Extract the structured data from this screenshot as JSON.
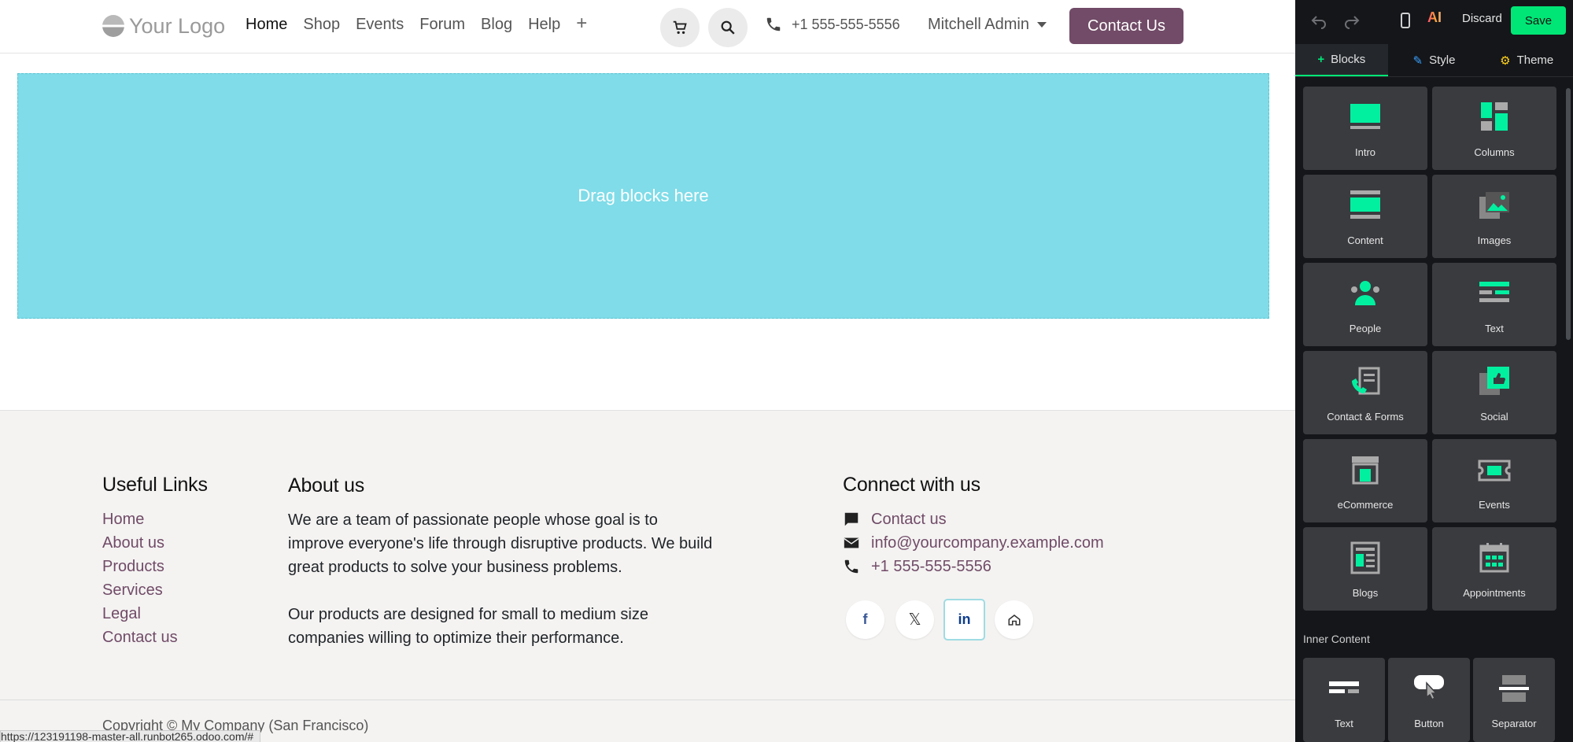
{
  "nav": {
    "logo_text": "Your Logo",
    "menu": [
      {
        "label": "Home"
      },
      {
        "label": "Shop"
      },
      {
        "label": "Events"
      },
      {
        "label": "Forum"
      },
      {
        "label": "Blog"
      },
      {
        "label": "Help"
      }
    ],
    "add_menu_label": "+",
    "phone": "+1 555-555-5556",
    "user": "Mitchell Admin",
    "contact_button": "Contact Us"
  },
  "dropzone": {
    "label": "Drag blocks here"
  },
  "footer": {
    "useful_links": {
      "title": "Useful Links",
      "items": [
        "Home",
        "About us",
        "Products",
        "Services",
        "Legal",
        "Contact us"
      ]
    },
    "about": {
      "title": "About us",
      "p1": "We are a team of passionate people whose goal is to improve everyone's life through disruptive products. We build great products to solve your business problems.",
      "p2": "Our products are designed for small to medium size companies willing to optimize their performance."
    },
    "connect": {
      "title": "Connect with us",
      "contact": "Contact us",
      "email": "info@yourcompany.example.com",
      "phone": "+1 555-555-5556"
    },
    "copyright": "Copyright © My Company (San Francisco)"
  },
  "status_url": "https://123191198-master-all.runbot265.odoo.com/#",
  "editor": {
    "discard": "Discard",
    "save": "Save",
    "ai_label": "AI",
    "tabs": [
      {
        "label": "Blocks",
        "icon": "plus"
      },
      {
        "label": "Style",
        "icon": "pencil"
      },
      {
        "label": "Theme",
        "icon": "gear"
      }
    ],
    "blocks": [
      {
        "label": "Intro",
        "icon": "intro-icon"
      },
      {
        "label": "Columns",
        "icon": "columns-icon"
      },
      {
        "label": "Content",
        "icon": "content-icon"
      },
      {
        "label": "Images",
        "icon": "images-icon"
      },
      {
        "label": "People",
        "icon": "people-icon"
      },
      {
        "label": "Text",
        "icon": "text-icon"
      },
      {
        "label": "Contact & Forms",
        "icon": "contact-forms-icon"
      },
      {
        "label": "Social",
        "icon": "social-icon"
      },
      {
        "label": "eCommerce",
        "icon": "ecommerce-icon"
      },
      {
        "label": "Events",
        "icon": "events-icon"
      },
      {
        "label": "Blogs",
        "icon": "blogs-icon"
      },
      {
        "label": "Appointments",
        "icon": "appointments-icon"
      }
    ],
    "inner_content_title": "Inner Content",
    "inner_blocks": [
      {
        "label": "Text",
        "icon": "inner-text-icon"
      },
      {
        "label": "Button",
        "icon": "button-icon"
      },
      {
        "label": "Separator",
        "icon": "separator-icon"
      }
    ],
    "colors": {
      "accent": "#00e676",
      "panel": "#141619",
      "tile": "#3a3b3f"
    }
  }
}
